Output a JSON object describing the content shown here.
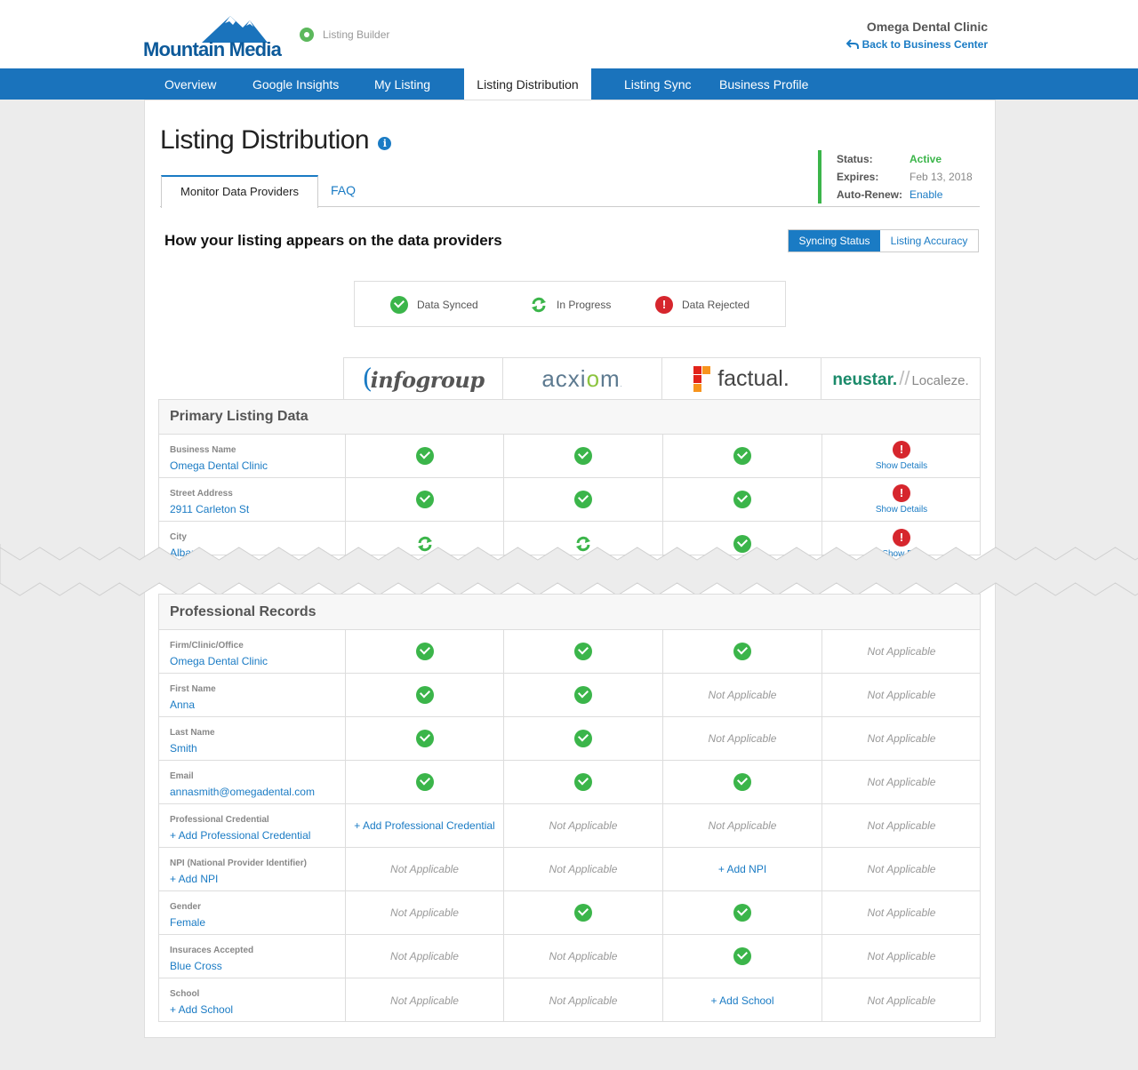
{
  "brand": {
    "logo_text": "Mountain Media",
    "product": "Listing Builder"
  },
  "header": {
    "business_name": "Omega Dental Clinic",
    "back_link": "Back to Business Center"
  },
  "nav": [
    "Overview",
    "Google Insights",
    "My Listing",
    "Listing Distribution",
    "Listing Sync",
    "Business Profile"
  ],
  "nav_active": "Listing Distribution",
  "page": {
    "title": "Listing Distribution",
    "info_glyph": "i",
    "tabs": [
      "Monitor Data Providers",
      "FAQ"
    ],
    "subheading": "How your listing appears on the data providers"
  },
  "status": {
    "status_label": "Status:",
    "status_value": "Active",
    "expires_label": "Expires:",
    "expires_value": "Feb 13, 2018",
    "autorenew_label": "Auto-Renew:",
    "autorenew_value": "Enable"
  },
  "toggle": {
    "on": "Syncing Status",
    "off": "Listing Accuracy"
  },
  "legend": {
    "synced": "Data Synced",
    "progress": "In Progress",
    "rejected": "Data Rejected"
  },
  "providers": {
    "infogroup": {
      "c": "(",
      "text": "infogroup"
    },
    "acxiom": {
      "a": "acxi",
      "o": "o",
      "m": "m",
      "tm": "."
    },
    "factual": "factual.",
    "neustar": {
      "name": "neustar.",
      "slash": "//",
      "loc": "Localeze."
    }
  },
  "icons": {
    "ok": "check-circle-icon",
    "bad": "exclamation-circle-icon",
    "prog": "sync-arrows-icon"
  },
  "colors": {
    "nav_blue": "#1a73bc",
    "link": "#1a7bc4",
    "green": "#3bb54a",
    "red": "#d6262d"
  },
  "primary": {
    "heading": "Primary Listing Data",
    "rows": [
      {
        "label": "Business Name",
        "value": "Omega Dental Clinic",
        "cells": [
          "ok",
          "ok",
          "ok",
          "bad"
        ],
        "details": "Show Details"
      },
      {
        "label": "Street Address",
        "value": "2911 Carleton St",
        "cells": [
          "ok",
          "ok",
          "ok",
          "bad"
        ],
        "details": "Show Details"
      },
      {
        "label": "City",
        "value": "Alban",
        "cells": [
          "prog",
          "prog",
          "ok",
          "bad"
        ],
        "details": "Show Det"
      }
    ]
  },
  "professional": {
    "heading": "Professional Records",
    "not_applicable": "Not Applicable",
    "rows": [
      {
        "label": "Firm/Clinic/Office",
        "value": "Omega Dental Clinic",
        "cells": [
          "ok",
          "ok",
          "ok",
          "na"
        ]
      },
      {
        "label": "First Name",
        "value": "Anna",
        "cells": [
          "ok",
          "ok",
          "na",
          "na"
        ]
      },
      {
        "label": "Last Name",
        "value": "Smith",
        "cells": [
          "ok",
          "ok",
          "na",
          "na"
        ]
      },
      {
        "label": "Email",
        "value": "annasmith@omegadental.com",
        "cells": [
          "ok",
          "ok",
          "ok",
          "na"
        ]
      },
      {
        "label": "Professional Credential",
        "value": "+ Add Professional Credential",
        "cells": [
          "+ Add Professional Credential",
          "na",
          "na",
          "na"
        ]
      },
      {
        "label": "NPI (National Provider Identifier)",
        "value": "+ Add NPI",
        "cells": [
          "na",
          "na",
          "+ Add NPI",
          "na"
        ]
      },
      {
        "label": "Gender",
        "value": "Female",
        "cells": [
          "na",
          "ok",
          "ok",
          "na"
        ]
      },
      {
        "label": "Insuraces Accepted",
        "value": "Blue Cross",
        "cells": [
          "na",
          "na",
          "ok",
          "na"
        ]
      },
      {
        "label": "School",
        "value": "+ Add School",
        "cells": [
          "na",
          "na",
          "+ Add School",
          "na"
        ]
      }
    ]
  }
}
